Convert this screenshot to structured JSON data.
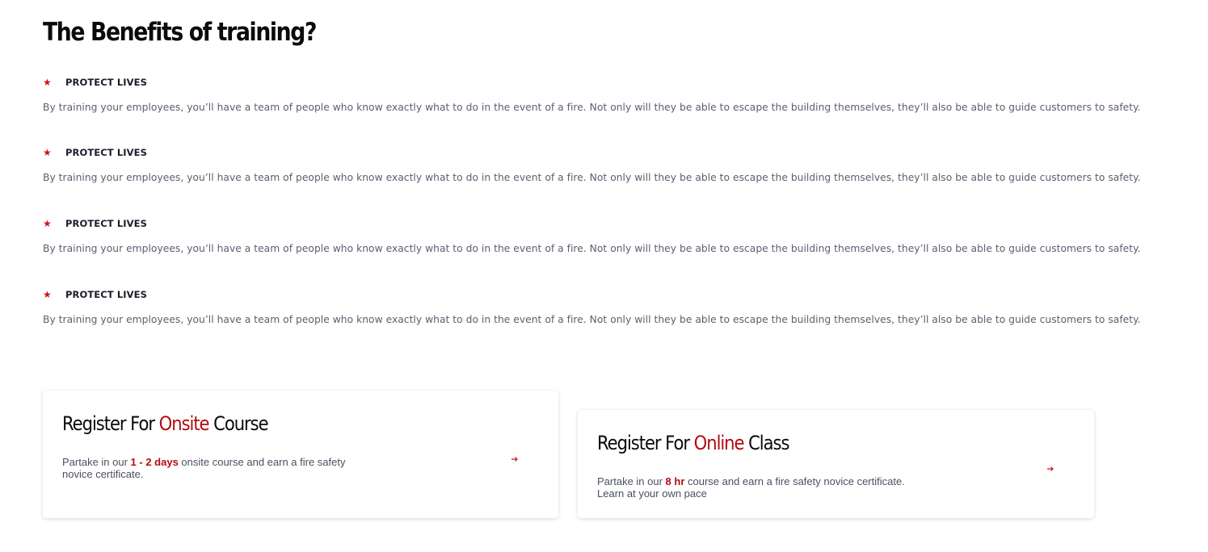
{
  "heading": "The Benefits of training?",
  "benefits": [
    {
      "title": "PROTECT LIVES",
      "description": "By training your employees, you’ll have a team of people who know exactly what to do in the event of a fire. Not only will they be able to escape the building themselves, they’ll also be able to guide customers to safety."
    },
    {
      "title": "PROTECT LIVES",
      "description": "By training your employees, you’ll have a team of people who know exactly what to do in the event of a fire. Not only will they be able to escape the building themselves, they’ll also be able to guide customers to safety."
    },
    {
      "title": "PROTECT LIVES",
      "description": "By training your employees, you’ll have a team of people who know exactly what to do in the event of a fire. Not only will they be able to escape the building themselves, they’ll also be able to guide customers to safety."
    },
    {
      "title": "PROTECT LIVES",
      "description": "By training your employees, you’ll have a team of people who know exactly what to do in the event of a fire. Not only will they be able to escape the building themselves, they’ll also be able to guide customers to safety."
    }
  ],
  "onsite_card": {
    "title_prefix": "Register For ",
    "title_accent": "Onsite",
    "title_suffix": " Course",
    "desc_prefix": "Partake in our ",
    "desc_highlight": "1 - 2 days",
    "desc_suffix": " onsite course and earn a fire safety novice certificate."
  },
  "online_card": {
    "title_prefix": "Register For ",
    "title_accent": "Online",
    "title_suffix": " Class",
    "desc_prefix": "Partake in our ",
    "desc_highlight": "8 hr",
    "desc_suffix": " course and earn a fire safety novice certificate. Learn at your own pace"
  },
  "colors": {
    "accent": "#b30b11",
    "star": "#d0101c",
    "body_text": "#5b6070"
  },
  "icons": {
    "bullet": "star-icon",
    "card_link": "arrow-right-icon"
  }
}
